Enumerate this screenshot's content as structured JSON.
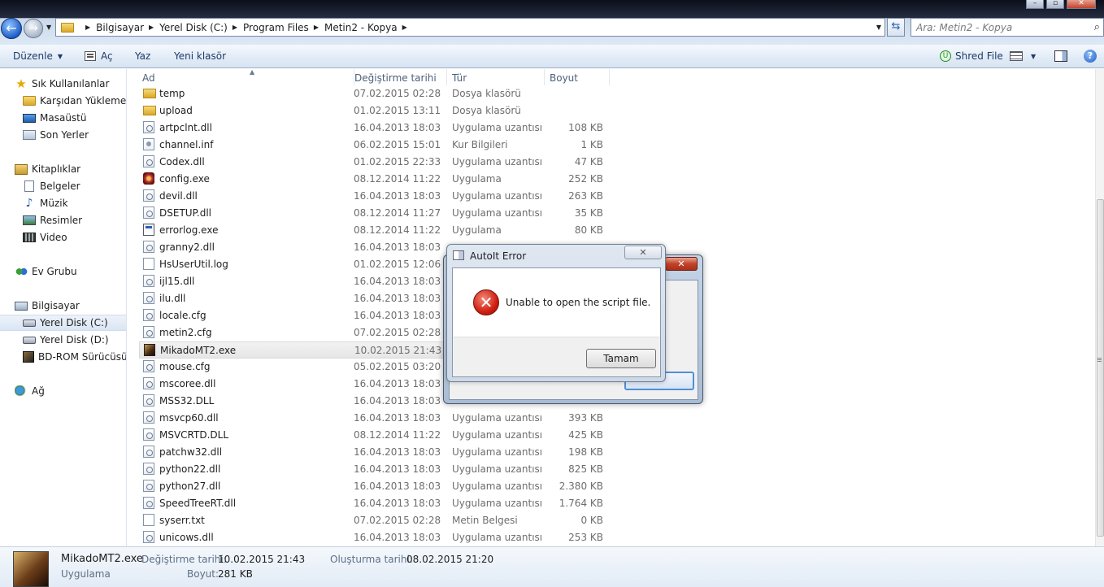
{
  "window": {
    "minimize_label": "–",
    "maximize_label": "▫",
    "close_label": "✕"
  },
  "address": {
    "crumbs": [
      "Bilgisayar",
      "Yerel Disk (C:)",
      "Program Files",
      "Metin2 - Kopya"
    ],
    "search_placeholder": "Ara: Metin2 - Kopya"
  },
  "toolbar": {
    "organize": "Düzenle",
    "open": "Aç",
    "write": "Yaz",
    "new_folder": "Yeni klasör",
    "shred": "Shred File"
  },
  "nav": {
    "favorites": "Sık Kullanılanlar",
    "downloads": "Karşıdan Yüklemeler",
    "desktop": "Masaüstü",
    "recent": "Son Yerler",
    "libraries": "Kitaplıklar",
    "documents": "Belgeler",
    "music": "Müzik",
    "pictures": "Resimler",
    "video": "Video",
    "homegroup": "Ev Grubu",
    "computer": "Bilgisayar",
    "drive_c": "Yerel Disk (C:)",
    "drive_d": "Yerel Disk (D:)",
    "bd_rom": "BD-ROM Sürücüsü (",
    "network": "Ağ"
  },
  "columns": {
    "name": "Ad",
    "modified": "Değiştirme tarihi",
    "type": "Tür",
    "size": "Boyut"
  },
  "files": [
    {
      "name": "temp",
      "date": "07.02.2015 02:28",
      "type": "Dosya klasörü",
      "size": "",
      "icon": "folder"
    },
    {
      "name": "upload",
      "date": "01.02.2015 13:11",
      "type": "Dosya klasörü",
      "size": "",
      "icon": "folder"
    },
    {
      "name": "artpclnt.dll",
      "date": "16.04.2013 18:03",
      "type": "Uygulama uzantısı",
      "size": "108 KB",
      "icon": "dll"
    },
    {
      "name": "channel.inf",
      "date": "06.02.2015 15:01",
      "type": "Kur Bilgileri",
      "size": "1 KB",
      "icon": "inf"
    },
    {
      "name": "Codex.dll",
      "date": "01.02.2015 22:33",
      "type": "Uygulama uzantısı",
      "size": "47 KB",
      "icon": "dll"
    },
    {
      "name": "config.exe",
      "date": "08.12.2014 11:22",
      "type": "Uygulama",
      "size": "252 KB",
      "icon": "exe-cfg"
    },
    {
      "name": "devil.dll",
      "date": "16.04.2013 18:03",
      "type": "Uygulama uzantısı",
      "size": "263 KB",
      "icon": "dll"
    },
    {
      "name": "DSETUP.dll",
      "date": "08.12.2014 11:27",
      "type": "Uygulama uzantısı",
      "size": "35 KB",
      "icon": "dll"
    },
    {
      "name": "errorlog.exe",
      "date": "08.12.2014 11:22",
      "type": "Uygulama",
      "size": "80 KB",
      "icon": "exe-err"
    },
    {
      "name": "granny2.dll",
      "date": "16.04.2013 18:03",
      "type": "",
      "size": "",
      "icon": "dll"
    },
    {
      "name": "HsUserUtil.log",
      "date": "01.02.2015 12:06",
      "type": "",
      "size": "",
      "icon": "doc"
    },
    {
      "name": "ijl15.dll",
      "date": "16.04.2013 18:03",
      "type": "",
      "size": "",
      "icon": "dll"
    },
    {
      "name": "ilu.dll",
      "date": "16.04.2013 18:03",
      "type": "",
      "size": "",
      "icon": "dll"
    },
    {
      "name": "locale.cfg",
      "date": "16.04.2013 18:03",
      "type": "",
      "size": "",
      "icon": "dll"
    },
    {
      "name": "metin2.cfg",
      "date": "07.02.2015 02:28",
      "type": "",
      "size": "",
      "icon": "dll"
    },
    {
      "name": "MikadoMT2.exe",
      "date": "10.02.2015 21:43",
      "type": "",
      "size": "",
      "icon": "mikado"
    },
    {
      "name": "mouse.cfg",
      "date": "05.02.2015 03:20",
      "type": "",
      "size": "",
      "icon": "dll"
    },
    {
      "name": "mscoree.dll",
      "date": "16.04.2013 18:03",
      "type": "",
      "size": "",
      "icon": "dll"
    },
    {
      "name": "MSS32.DLL",
      "date": "16.04.2013 18:03",
      "type": "",
      "size": "",
      "icon": "dll"
    },
    {
      "name": "msvcp60.dll",
      "date": "16.04.2013 18:03",
      "type": "Uygulama uzantısı",
      "size": "393 KB",
      "icon": "dll"
    },
    {
      "name": "MSVCRTD.DLL",
      "date": "08.12.2014 11:22",
      "type": "Uygulama uzantısı",
      "size": "425 KB",
      "icon": "dll"
    },
    {
      "name": "patchw32.dll",
      "date": "16.04.2013 18:03",
      "type": "Uygulama uzantısı",
      "size": "198 KB",
      "icon": "dll"
    },
    {
      "name": "python22.dll",
      "date": "16.04.2013 18:03",
      "type": "Uygulama uzantısı",
      "size": "825 KB",
      "icon": "dll"
    },
    {
      "name": "python27.dll",
      "date": "16.04.2013 18:03",
      "type": "Uygulama uzantısı",
      "size": "2.380 KB",
      "icon": "dll"
    },
    {
      "name": "SpeedTreeRT.dll",
      "date": "16.04.2013 18:03",
      "type": "Uygulama uzantısı",
      "size": "1.764 KB",
      "icon": "dll"
    },
    {
      "name": "syserr.txt",
      "date": "07.02.2015 02:28",
      "type": "Metin Belgesi",
      "size": "0 KB",
      "icon": "doc"
    },
    {
      "name": "unicows.dll",
      "date": "16.04.2013 18:03",
      "type": "Uygulama uzantısı",
      "size": "253 KB",
      "icon": "dll"
    }
  ],
  "details": {
    "filename": "MikadoMT2.exe",
    "filetype": "Uygulama",
    "modified_label": "Değiştirme tarihi:",
    "modified_value": "10.02.2015 21:43",
    "size_label": "Boyut:",
    "size_value": "281 KB",
    "created_label": "Oluşturma tarihi:",
    "created_value": "08.02.2015 21:20"
  },
  "dialog": {
    "title": "AutoIt Error",
    "message": "Unable to open the script file.",
    "ok_label": "Tamam",
    "close_label": "✕",
    "icon": "error-icon"
  },
  "colors": {
    "accent": "#1f5fc7",
    "error": "#d11f10",
    "selection": "#e6e6e6"
  }
}
